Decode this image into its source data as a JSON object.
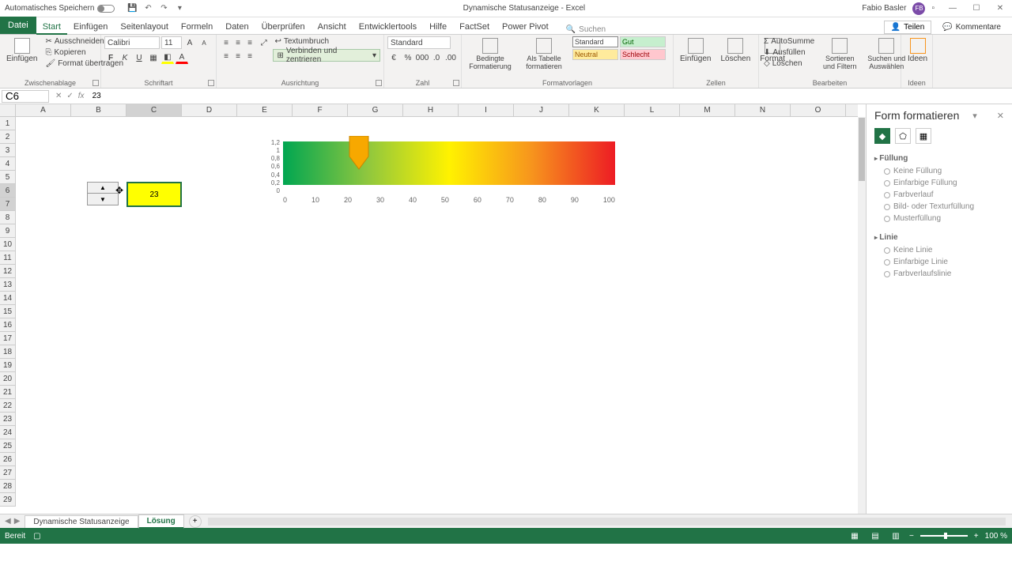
{
  "titlebar": {
    "autosave_label": "Automatisches Speichern",
    "doc_title": "Dynamische Statusanzeige - Excel",
    "user_name": "Fabio Basler",
    "user_initials": "FB"
  },
  "tabs": {
    "file": "Datei",
    "items": [
      "Start",
      "Einfügen",
      "Seitenlayout",
      "Formeln",
      "Daten",
      "Überprüfen",
      "Ansicht",
      "Entwicklertools",
      "Hilfe",
      "FactSet",
      "Power Pivot"
    ],
    "active_index": 0,
    "search_placeholder": "Suchen",
    "share_label": "Teilen",
    "comments_label": "Kommentare"
  },
  "ribbon": {
    "clipboard": {
      "label": "Zwischenablage",
      "paste": "Einfügen",
      "cut": "Ausschneiden",
      "copy": "Kopieren",
      "painter": "Format übertragen"
    },
    "font": {
      "label": "Schriftart",
      "name": "Calibri",
      "size": "11"
    },
    "alignment": {
      "label": "Ausrichtung",
      "wrap": "Textumbruch",
      "merge": "Verbinden und zentrieren"
    },
    "number": {
      "label": "Zahl",
      "format": "Standard"
    },
    "styles": {
      "label": "Formatvorlagen",
      "conditional": "Bedingte Formatierung",
      "as_table": "Als Tabelle formatieren",
      "standard": "Standard",
      "gut": "Gut",
      "neutral": "Neutral",
      "schlecht": "Schlecht"
    },
    "cells": {
      "label": "Zellen",
      "insert": "Einfügen",
      "delete": "Löschen",
      "format": "Format"
    },
    "editing": {
      "label": "Bearbeiten",
      "autosum": "AutoSumme",
      "fill": "Ausfüllen",
      "clear": "Löschen",
      "sort": "Sortieren und Filtern",
      "find": "Suchen und Auswählen"
    },
    "ideas": {
      "label": "Ideen",
      "btn": "Ideen"
    }
  },
  "formula_bar": {
    "cell_ref": "C6",
    "formula": "23"
  },
  "columns": [
    "A",
    "B",
    "C",
    "D",
    "E",
    "F",
    "G",
    "H",
    "I",
    "J",
    "K",
    "L",
    "M",
    "N",
    "O"
  ],
  "selected_col": "C",
  "rows": [
    1,
    2,
    3,
    4,
    5,
    6,
    7,
    8,
    9,
    10,
    11,
    12,
    13,
    14,
    15,
    16,
    17,
    18,
    19,
    20,
    21,
    22,
    23,
    24,
    25,
    26,
    27,
    28,
    29
  ],
  "selected_rows": [
    6,
    7
  ],
  "cell_value": "23",
  "chart_data": {
    "type": "bar",
    "pointer_value": 23,
    "x_labels": [
      "0",
      "10",
      "20",
      "30",
      "40",
      "50",
      "60",
      "70",
      "80",
      "90",
      "100"
    ],
    "y_labels": [
      "1,2",
      "1",
      "0,8",
      "0,6",
      "0,4",
      "0,2",
      "0"
    ],
    "xlim": [
      0,
      100
    ],
    "ylim": [
      0,
      1.2
    ]
  },
  "side_pane": {
    "title": "Form formatieren",
    "sections": {
      "fill": {
        "title": "Füllung",
        "options": [
          "Keine Füllung",
          "Einfarbige Füllung",
          "Farbverlauf",
          "Bild- oder Texturfüllung",
          "Musterfüllung"
        ]
      },
      "line": {
        "title": "Linie",
        "options": [
          "Keine Linie",
          "Einfarbige Linie",
          "Farbverlaufslinie"
        ]
      }
    }
  },
  "sheet_tabs": {
    "items": [
      "Dynamische Statusanzeige",
      "Lösung"
    ],
    "active_index": 1
  },
  "statusbar": {
    "status": "Bereit",
    "zoom": "100 %"
  }
}
